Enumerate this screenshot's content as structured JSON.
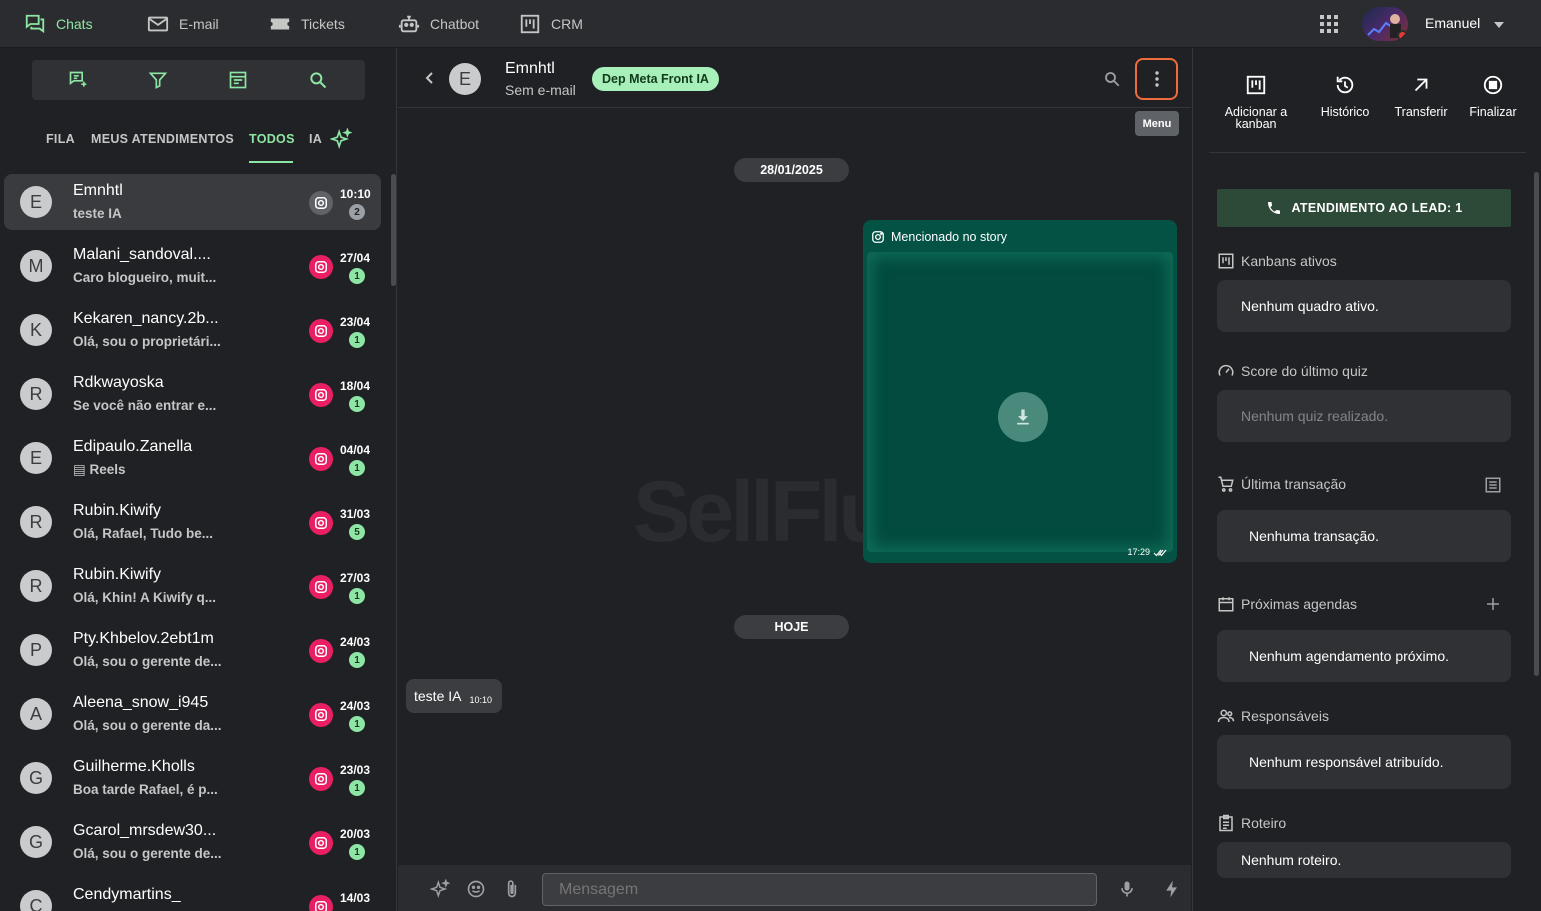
{
  "topnav": {
    "items": [
      {
        "label": "Chats",
        "icon": "chat-bubbles-icon"
      },
      {
        "label": "E-mail",
        "icon": "mail-icon"
      },
      {
        "label": "Tickets",
        "icon": "ticket-icon"
      },
      {
        "label": "Chatbot",
        "icon": "robot-icon"
      },
      {
        "label": "CRM",
        "icon": "kanban-icon"
      }
    ],
    "user_name": "Emanuel"
  },
  "left": {
    "tabs": [
      "FILA",
      "MEUS ATENDIMENTOS",
      "TODOS",
      "IA"
    ],
    "active_tab": "TODOS",
    "chats": [
      {
        "initial": "E",
        "name": "Emnhtl",
        "preview": "teste IA",
        "time": "10:10",
        "badge": "2",
        "selected": true
      },
      {
        "initial": "M",
        "name": "Malani_sandoval....",
        "preview": "Caro blogueiro, muit...",
        "time": "27/04",
        "badge": "1"
      },
      {
        "initial": "K",
        "name": "Kekaren_nancy.2b...",
        "preview": "Olá, sou o proprietári...",
        "time": "23/04",
        "badge": "1"
      },
      {
        "initial": "R",
        "name": "Rdkwayoska",
        "preview": "Se você não entrar e...",
        "time": "18/04",
        "badge": "1"
      },
      {
        "initial": "E",
        "name": "Edipaulo.Zanella",
        "preview": "▤ Reels",
        "time": "04/04",
        "badge": "1"
      },
      {
        "initial": "R",
        "name": "Rubin.Kiwify",
        "preview": "Olá, Rafael, Tudo be...",
        "time": "31/03",
        "badge": "5"
      },
      {
        "initial": "R",
        "name": "Rubin.Kiwify",
        "preview": "Olá, Khin! A Kiwify q...",
        "time": "27/03",
        "badge": "1"
      },
      {
        "initial": "P",
        "name": "Pty.Khbelov.2ebt1m",
        "preview": "Olá, sou o gerente de...",
        "time": "24/03",
        "badge": "1"
      },
      {
        "initial": "A",
        "name": "Aleena_snow_i945",
        "preview": "Olá, sou o gerente da...",
        "time": "24/03",
        "badge": "1"
      },
      {
        "initial": "G",
        "name": "Guilherme.Kholls",
        "preview": "Boa tarde Rafael, é p...",
        "time": "23/03",
        "badge": "1"
      },
      {
        "initial": "G",
        "name": "Gcarol_mrsdew30...",
        "preview": "Olá, sou o gerente de...",
        "time": "20/03",
        "badge": "1"
      },
      {
        "initial": "C",
        "name": "Cendymartins_",
        "preview": "",
        "time": "14/03",
        "badge": ""
      }
    ]
  },
  "conversation": {
    "contact_initial": "E",
    "contact_name": "Emnhtl",
    "contact_email": "Sem e-mail",
    "department": "Dep Meta Front IA",
    "menu_tooltip": "Menu",
    "date_1": "28/01/2025",
    "story_label": "Mencionado no story",
    "story_time": "17:29",
    "watermark": "SellFlux",
    "date_2": "HOJE",
    "incoming_text": "teste IA",
    "incoming_time": "10:10",
    "input_placeholder": "Mensagem"
  },
  "right": {
    "actions": [
      {
        "label": "Adicionar a kanban"
      },
      {
        "label": "Histórico"
      },
      {
        "label": "Transferir"
      },
      {
        "label": "Finalizar"
      }
    ],
    "lead_button": "ATENDIMENTO AO LEAD: 1",
    "sections": {
      "kanbans_title": "Kanbans ativos",
      "kanbans_value": "Nenhum quadro ativo.",
      "quiz_title": "Score do último quiz",
      "quiz_value": "Nenhum quiz realizado.",
      "transacao_title": "Última transação",
      "transacao_value": "Nenhuma transação.",
      "agendas_title": "Próximas agendas",
      "agendas_value": "Nenhum agendamento próximo.",
      "responsaveis_title": "Responsáveis",
      "responsaveis_value": "Nenhum responsável atribuído.",
      "roteiro_title": "Roteiro",
      "roteiro_value": "Nenhum roteiro."
    }
  },
  "colors": {
    "accent_green": "#8ee6a4",
    "instagram_pink": "#e91e63",
    "story_green": "#035244",
    "menu_highlight": "#f06b3b"
  }
}
